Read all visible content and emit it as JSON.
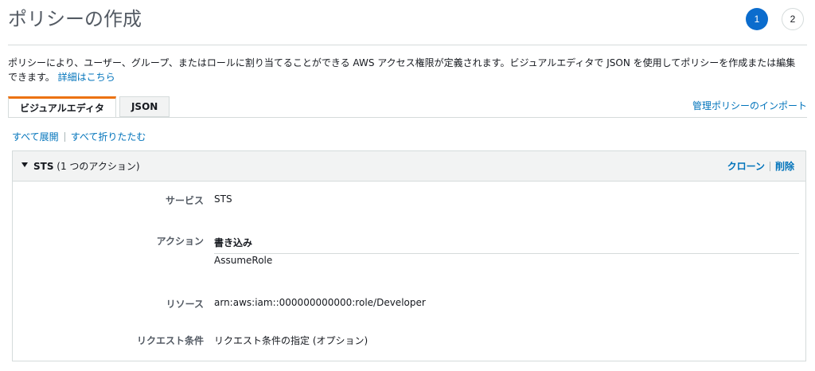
{
  "page": {
    "title": "ポリシーの作成",
    "steps": [
      "1",
      "2"
    ],
    "description": "ポリシーにより、ユーザー、グループ、またはロールに割り当てることができる AWS アクセス権限が定義されます。ビジュアルエディタで JSON を使用してポリシーを作成または編集できます。",
    "details_link": "詳細はこちら"
  },
  "tabs": [
    {
      "label": "ビジュアルエディタ",
      "active": true
    },
    {
      "label": "JSON",
      "active": false
    }
  ],
  "import_link": "管理ポリシーのインポート",
  "expand_all": "すべて展開",
  "collapse_all": "すべて折りたたむ",
  "panel": {
    "title_bold": "STS",
    "title_rest": " (1 つのアクション)",
    "clone": "クローン",
    "delete": "削除",
    "rows": {
      "service_label": "サービス",
      "service_value": "STS",
      "action_label": "アクション",
      "action_group": "書き込み",
      "action_value": "AssumeRole",
      "resource_label": "リソース",
      "resource_value": "arn:aws:iam::000000000000:role/Developer",
      "condition_label": "リクエスト条件",
      "condition_link": "リクエスト条件の指定 (オプション)"
    }
  },
  "colors": {
    "accent_blue": "#0b6ccd",
    "link_blue": "#0073bb",
    "tab_accent_orange": "#ec7211"
  }
}
